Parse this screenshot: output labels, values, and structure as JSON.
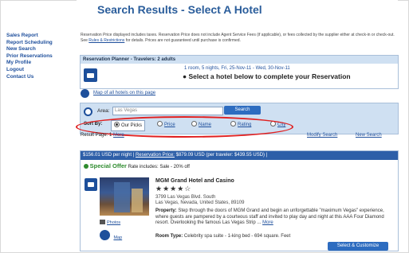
{
  "header": {
    "title": "Search Results - Select A Hotel"
  },
  "sidebar": {
    "items": [
      {
        "label": "Sales Report"
      },
      {
        "label": "Report Scheduling"
      },
      {
        "label": "New Search"
      },
      {
        "label": "Prior Reservations"
      },
      {
        "label": "My Profile"
      },
      {
        "label": "Logout"
      },
      {
        "label": "Contact Us"
      }
    ]
  },
  "disclaimer": {
    "text_before": "Reservation Price displayed includes taxes. Reservation Price does not include Agent Service Fees (if applicable), or fees collected by the supplier either at check-in or check-out. See ",
    "link": "Rules & Restrictions",
    "text_after": " for details. Prices are not guaranteed until purchase is confirmed."
  },
  "planner": {
    "header": "Reservation Planner - Travelers: 2 adults",
    "dates": "1 room, 5 nights, Fri, 25-Nov-11 - Wed, 30-Nov-11",
    "message": "Select a hotel below to complete your Reservation"
  },
  "map": {
    "link": "Map of all hotels on this page"
  },
  "search": {
    "area_label": "Area:",
    "area_value": "Las Vegas",
    "button": "Search",
    "sort_label": "Sort By:",
    "sort_options": [
      {
        "label": "Our Picks",
        "selected": true
      },
      {
        "label": "Price",
        "selected": false
      },
      {
        "label": "Name",
        "selected": false
      },
      {
        "label": "Rating",
        "selected": false
      },
      {
        "label": "City",
        "selected": false
      }
    ]
  },
  "results": {
    "page_label": "Result Page:",
    "page_current": "1",
    "page_more": "More",
    "modify_search": "Modify Search",
    "new_search": "New Search"
  },
  "hotel": {
    "price_bar_start": "$156.01 USD per night | ",
    "price_bar_link": "Reservation Price:",
    "price_bar_end": " $879.09 USD (per traveler: $439.55 USD) |",
    "offer_title": "Special Offer",
    "offer_desc": "Rate includes: Sale - 20% off",
    "name": "MGM Grand Hotel and Casino",
    "stars": "★★★★☆",
    "address_line1": "3799 Las Vegas Blvd. South",
    "address_line2": "Las Vegas, Nevada, United States, 89109",
    "property_label": "Property:",
    "property_text": "Step through the doors of MGM Grand and begin an unforgettable \"maximum Vegas\" experience, where guests are pampered by a courteous staff and invited to play day and night at this AAA Four Diamond resort. Overlooking the famous Las Vegas Strip ...",
    "property_more": "More",
    "photos_link": "Photos",
    "map_link": "Map",
    "room_type_label": "Room Type:",
    "room_type_value": "Celebrity spa suite - 1-king bed - 694 square. Feet",
    "select_button": "Select & Customize"
  },
  "colors": {
    "title_blue": "#2a5d9b",
    "link_blue": "#1e4f9c",
    "price_bar": "#2d5fa8",
    "panel_bg": "#cfe0f2",
    "offer_green": "#2e8b2e",
    "annotation_red": "#e02020"
  }
}
